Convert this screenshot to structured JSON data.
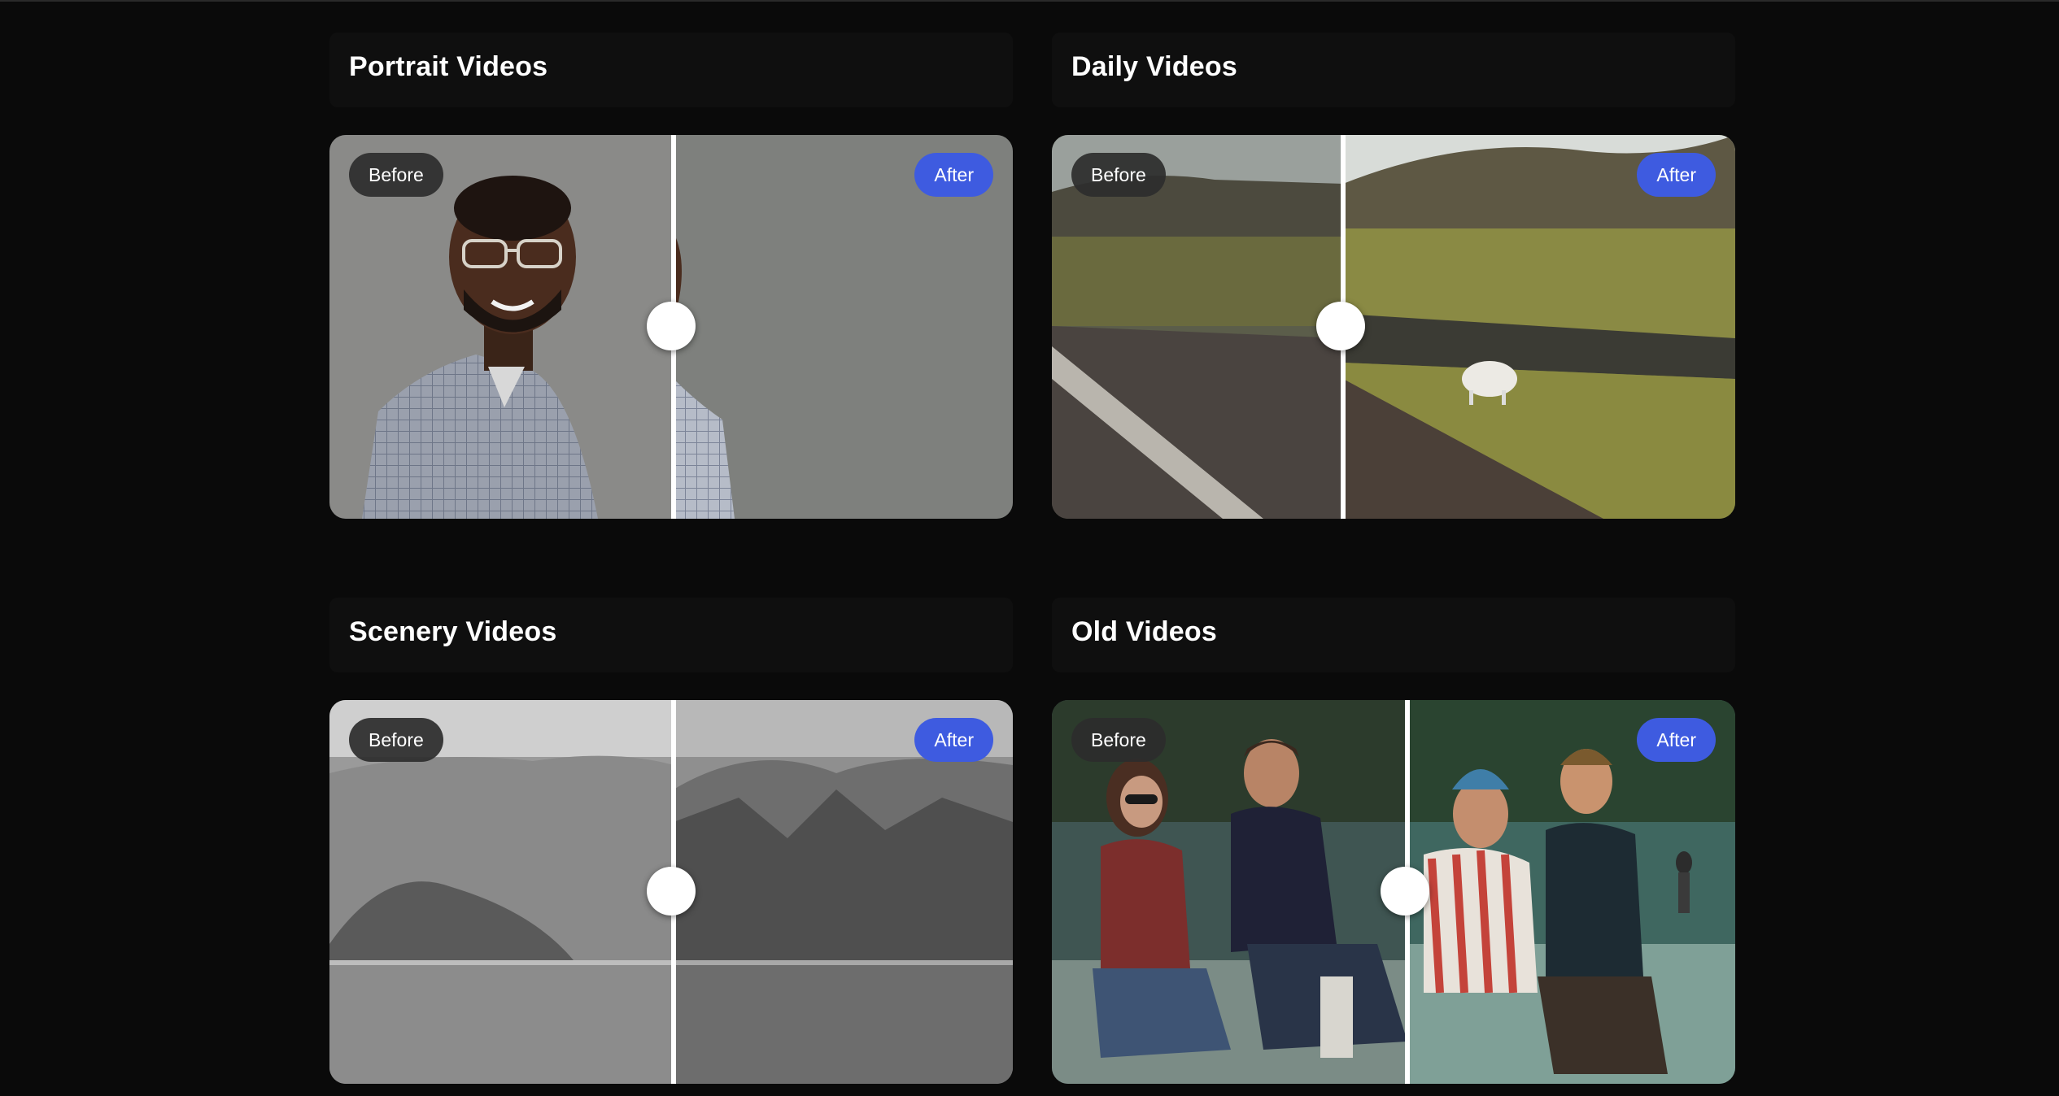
{
  "cards": [
    {
      "title": "Portrait Videos",
      "before_label": "Before",
      "after_label": "After"
    },
    {
      "title": "Daily Videos",
      "before_label": "Before",
      "after_label": "After"
    },
    {
      "title": "Scenery Videos",
      "before_label": "Before",
      "after_label": "After"
    },
    {
      "title": "Old Videos",
      "before_label": "Before",
      "after_label": "After"
    }
  ],
  "colors": {
    "background": "#0a0a0a",
    "after_badge": "#3e5be0",
    "before_badge": "#2d2d2d"
  },
  "icons": {
    "slider_handle": "circle-handle-icon"
  }
}
